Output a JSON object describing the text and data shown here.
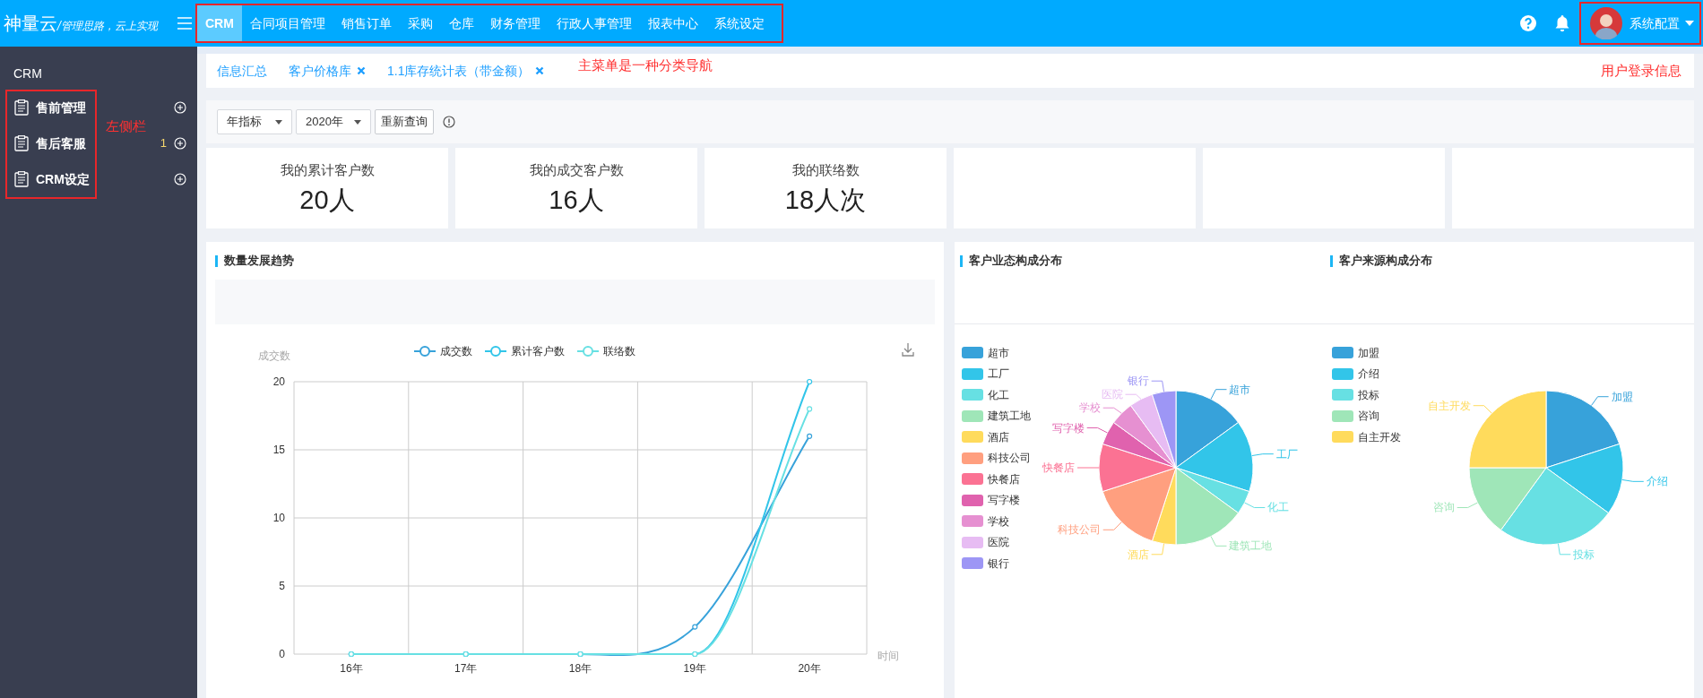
{
  "header": {
    "logo": "神量云",
    "slogan": "/管理思路，云上实现",
    "nav": [
      {
        "label": "CRM",
        "selected": true
      },
      {
        "label": "合同项目管理",
        "selected": false
      },
      {
        "label": "销售订单",
        "selected": false
      },
      {
        "label": "采购",
        "selected": false
      },
      {
        "label": "仓库",
        "selected": false
      },
      {
        "label": "财务管理",
        "selected": false
      },
      {
        "label": "行政人事管理",
        "selected": false
      },
      {
        "label": "报表中心",
        "selected": false
      },
      {
        "label": "系统设定",
        "selected": false
      }
    ],
    "user": "系统配置"
  },
  "annotations": {
    "nav": "主菜单是一种分类导航",
    "sidebar": "左侧栏",
    "user": "用户登录信息"
  },
  "sidebar": {
    "title": "CRM",
    "items": [
      {
        "label": "售前管理"
      },
      {
        "label": "售后客服",
        "badge": "1"
      },
      {
        "label": "CRM设定"
      }
    ]
  },
  "tabs": [
    {
      "label": "信息汇总",
      "closable": false
    },
    {
      "label": "客户价格库",
      "closable": true
    },
    {
      "label": "1.1库存统计表（带金额）",
      "closable": true
    }
  ],
  "filters": {
    "indicator": "年指标",
    "year": "2020年",
    "button": "重新查询"
  },
  "stats": [
    {
      "label": "我的累计客户数",
      "value": "20人"
    },
    {
      "label": "我的成交客户数",
      "value": "16人"
    },
    {
      "label": "我的联络数",
      "value": "18人次"
    }
  ],
  "charts": {
    "trend": {
      "title": "数量发展趋势",
      "chart_data": {
        "type": "line",
        "grid": true,
        "legend": "top",
        "xlabel": "时间",
        "ylabel": "成交数",
        "categories": [
          "16年",
          "17年",
          "18年",
          "19年",
          "20年"
        ],
        "ylim": [
          0,
          20
        ],
        "yticks": [
          0,
          5,
          10,
          15,
          20
        ],
        "series": [
          {
            "name": "成交数",
            "color": "#37a2da",
            "marker": "circle",
            "values": [
              0,
              0,
              0,
              2,
              16
            ]
          },
          {
            "name": "累计客户数",
            "color": "#32c5e9",
            "marker": "circle",
            "values": [
              0,
              0,
              0,
              0,
              20
            ]
          },
          {
            "name": "联络数",
            "color": "#67e0e3",
            "marker": "circle",
            "values": [
              0,
              0,
              0,
              0,
              18
            ]
          }
        ]
      }
    },
    "industry": {
      "chart_data": {
        "type": "pie",
        "legend": "left",
        "title": "客户业态构成分布",
        "categories": [
          "超市",
          "工厂",
          "化工",
          "建筑工地",
          "酒店",
          "科技公司",
          "快餐店",
          "写字楼",
          "学校",
          "医院",
          "银行"
        ],
        "values": [
          15,
          15,
          5,
          15,
          5,
          15,
          10,
          5,
          5,
          5,
          5
        ],
        "colors": [
          "#37a2da",
          "#32c5e9",
          "#67e0e3",
          "#9fe6b8",
          "#ffdb5c",
          "#ff9f7f",
          "#fb7293",
          "#e062ae",
          "#e690d1",
          "#e7bcf3",
          "#9d96f5"
        ]
      }
    },
    "source": {
      "chart_data": {
        "type": "pie",
        "legend": "left",
        "title": "客户来源构成分布",
        "categories": [
          "加盟",
          "介绍",
          "投标",
          "咨询",
          "自主开发"
        ],
        "values": [
          20,
          15,
          25,
          15,
          25
        ],
        "colors": [
          "#37a2da",
          "#32c5e9",
          "#67e0e3",
          "#9fe6b8",
          "#ffdb5c"
        ]
      }
    }
  }
}
